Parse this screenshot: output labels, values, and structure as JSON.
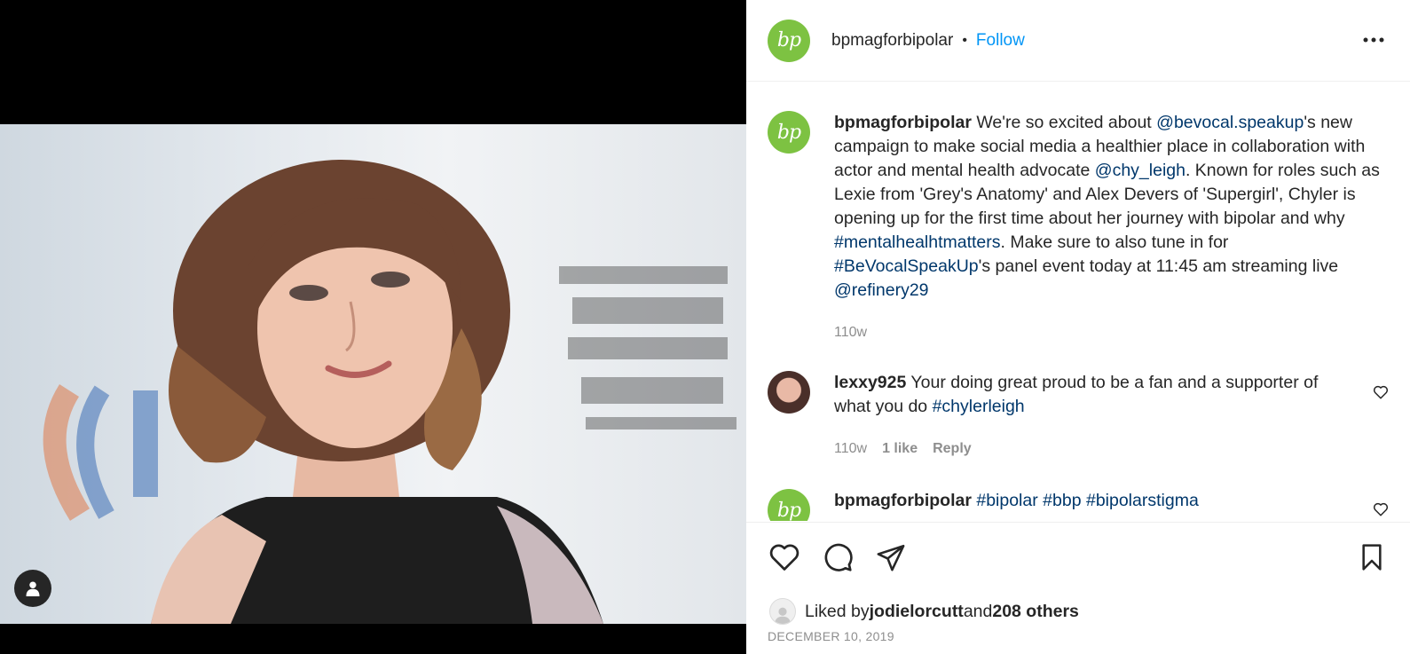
{
  "post": {
    "author": "bpmagforbipolar",
    "author_avatar_text": "bp",
    "dot": "•",
    "follow_label": "Follow",
    "more_icon": "more-horizontal-icon",
    "caption": {
      "username": "bpmagforbipolar",
      "t1": " We're so excited about ",
      "m1": "@bevocal.speakup",
      "t2": "'s new campaign to make social media a healthier place in collaboration with actor and mental health advocate ",
      "m2": "@chy_leigh",
      "t3": ". Known for roles such as Lexie from 'Grey's Anatomy' and Alex Devers of 'Supergirl', Chyler is opening up for the first time about her journey with bipolar and why ",
      "h1": "#mentalhealhtmatters",
      "t4": ". Make sure to also tune in for ",
      "h2": "#BeVocalSpeakUp",
      "t5": "'s panel event today at 11:45 am streaming live ",
      "m3": "@refinery29",
      "time": "110w"
    },
    "comments": [
      {
        "username": "lexxy925",
        "t1": " Your doing great proud to be a fan and a supporter of what you do ",
        "h1": "#chylerleigh",
        "time": "110w",
        "likes": "1 like",
        "reply": "Reply"
      },
      {
        "username": "bpmagforbipolar",
        "h1": "#bipolar",
        "h2": "#bbp",
        "h3": "#bipolarstigma"
      }
    ],
    "likes": {
      "prefix": "Liked by ",
      "user": "jodielorcutt",
      "and": " and ",
      "others": "208 others"
    },
    "date": "DECEMBER 10, 2019"
  },
  "colors": {
    "brand_green": "#7dc242",
    "follow_blue": "#0095f6",
    "link": "#00376b",
    "meta_gray": "#8e8e8e"
  }
}
